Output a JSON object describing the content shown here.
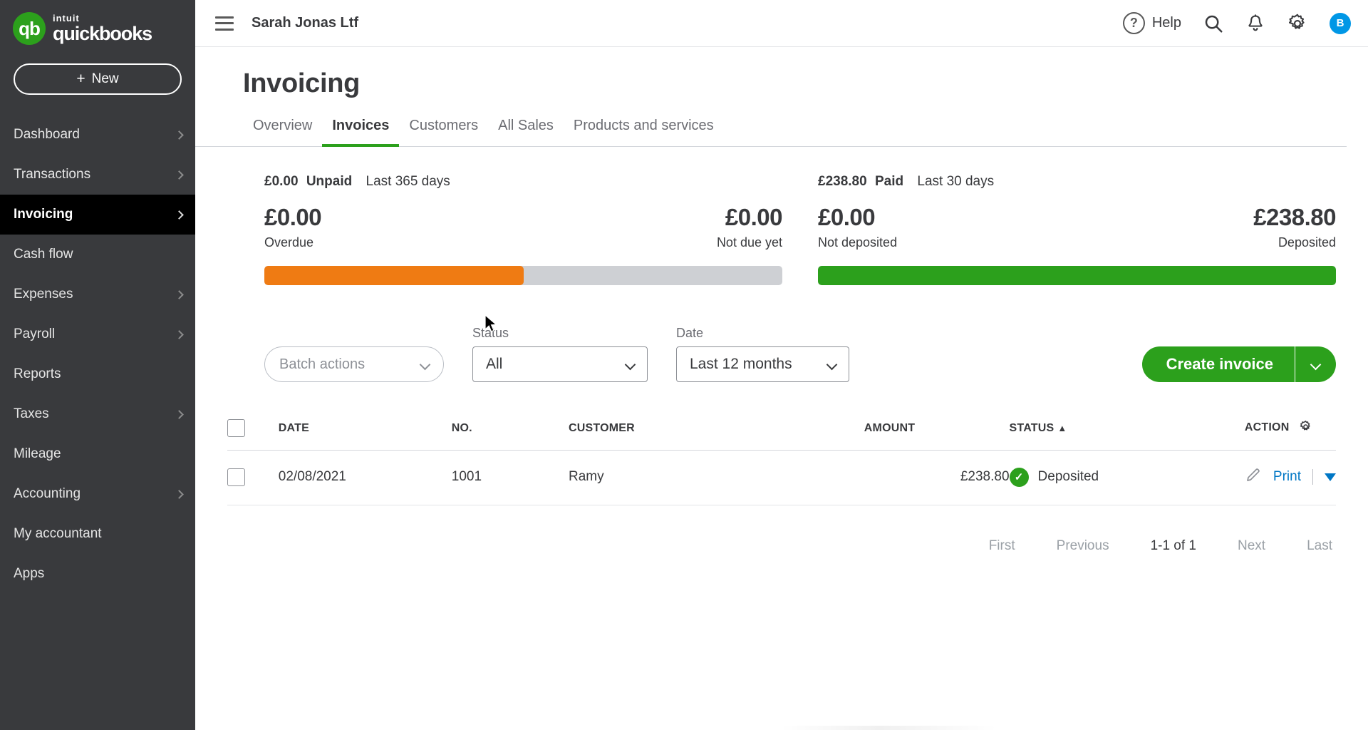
{
  "sidebar": {
    "logo": {
      "intuit": "intuit",
      "brand": "quickbooks",
      "mark": "qb"
    },
    "new_button": {
      "plus": "+",
      "label": "New"
    },
    "items": [
      {
        "label": "Dashboard",
        "has_chevron": true,
        "active": false
      },
      {
        "label": "Transactions",
        "has_chevron": true,
        "active": false
      },
      {
        "label": "Invoicing",
        "has_chevron": true,
        "active": true
      },
      {
        "label": "Cash flow",
        "has_chevron": false,
        "active": false
      },
      {
        "label": "Expenses",
        "has_chevron": true,
        "active": false
      },
      {
        "label": "Payroll",
        "has_chevron": true,
        "active": false
      },
      {
        "label": "Reports",
        "has_chevron": false,
        "active": false
      },
      {
        "label": "Taxes",
        "has_chevron": true,
        "active": false
      },
      {
        "label": "Mileage",
        "has_chevron": false,
        "active": false
      },
      {
        "label": "Accounting",
        "has_chevron": true,
        "active": false
      },
      {
        "label": "My accountant",
        "has_chevron": false,
        "active": false
      },
      {
        "label": "Apps",
        "has_chevron": false,
        "active": false
      }
    ]
  },
  "topbar": {
    "company": "Sarah Jonas Ltf",
    "help_label": "Help",
    "help_glyph": "?",
    "avatar_initial": "B"
  },
  "page": {
    "title": "Invoicing"
  },
  "tabs": [
    {
      "label": "Overview",
      "active": false
    },
    {
      "label": "Invoices",
      "active": true
    },
    {
      "label": "Customers",
      "active": false
    },
    {
      "label": "All Sales",
      "active": false
    },
    {
      "label": "Products and services",
      "active": false
    }
  ],
  "summary": {
    "unpaid": {
      "amount": "£0.00",
      "word": "Unpaid",
      "period": "Last 365 days",
      "left_amount": "£0.00",
      "left_label": "Overdue",
      "right_amount": "£0.00",
      "right_label": "Not due yet",
      "fill_percent": 50,
      "fill_color": "#ef7b13",
      "track_color": "#ced0d4"
    },
    "paid": {
      "amount": "£238.80",
      "word": "Paid",
      "period": "Last 30 days",
      "left_amount": "£0.00",
      "left_label": "Not deposited",
      "right_amount": "£238.80",
      "right_label": "Deposited",
      "fill_percent": 100,
      "fill_color": "#2ca01c",
      "track_color": "#ced0d4"
    }
  },
  "filters": {
    "batch_actions": "Batch actions",
    "status_label": "Status",
    "status_value": "All",
    "date_label": "Date",
    "date_value": "Last 12 months",
    "create_invoice": "Create invoice"
  },
  "table": {
    "columns": {
      "date": "DATE",
      "no": "NO.",
      "customer": "CUSTOMER",
      "amount": "AMOUNT",
      "status": "STATUS",
      "status_sort": "▲",
      "action": "ACTION"
    },
    "rows": [
      {
        "date": "02/08/2021",
        "no": "1001",
        "customer": "Ramy",
        "amount": "£238.80",
        "status": "Deposited",
        "status_check": "✓",
        "action_label": "Print"
      }
    ]
  },
  "pagination": {
    "first": "First",
    "previous": "Previous",
    "range": "1-1 of 1",
    "next": "Next",
    "last": "Last"
  },
  "colors": {
    "brand_green": "#2ca01c",
    "orange": "#ef7b13",
    "link_blue": "#0077c5",
    "sidebar": "#393a3d",
    "avatar_blue": "#0097e6"
  }
}
